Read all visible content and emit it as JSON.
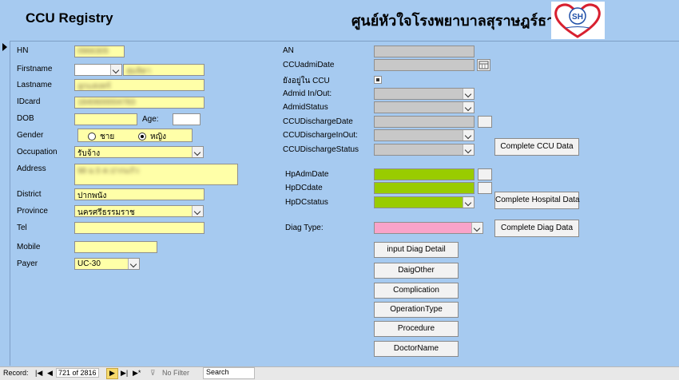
{
  "header": {
    "title": "CCU Registry",
    "hospital": "ศูนย์หัวใจโรงพยาบาลสุราษฎร์ธานี",
    "logo_text": "SH"
  },
  "left": {
    "hn_label": "HN",
    "hn_value": "0966305",
    "firstname_label": "Firstname",
    "firstname_value": "สุมลิตา",
    "lastname_label": "Lastname",
    "lastname_value": "ลูกแสงทร์",
    "idcard_label": "IDcard",
    "idcard_value": "1840600004783",
    "dob_label": "DOB",
    "dob_value": "",
    "age_label": "Age:",
    "age_value": "",
    "gender_label": "Gender",
    "gender_male": "ชาย",
    "gender_female": "หญิง",
    "occupation_label": "Occupation",
    "occupation_value": "รับจ้าง",
    "address_label": "Address",
    "address_value": "98 ม.5 ต.ปากแก้ว",
    "district_label": "District",
    "district_value": "ปากพนัง",
    "province_label": "Province",
    "province_value": "นครศรีธรรมราช",
    "tel_label": "Tel",
    "tel_value": "",
    "mobile_label": "Mobile",
    "mobile_value": "",
    "payer_label": "Payer",
    "payer_value": "UC-30"
  },
  "right": {
    "an_label": "AN",
    "ccu_admit_date_label": "CCUadmiDate",
    "still_in_ccu_label": "ยังอยู่ใน CCU",
    "admid_inout_label": "Admid In/Out:",
    "admid_status_label": "AdmidStatus",
    "discharge_date_label": "CCUDischargeDate",
    "discharge_inout_label": "CCUDischargeInOut:",
    "discharge_status_label": "CCUDischargeStatus",
    "complete_ccu_button": "Complete CCU Data",
    "hp_adm_date_label": "HpAdmDate",
    "hp_dc_date_label": "HpDCdate",
    "hp_dc_status_label": "HpDCstatus",
    "complete_hospital_button": "Complete Hospital Data",
    "diag_type_label": "Diag Type:",
    "complete_diag_button": "Complete Diag Data",
    "buttons": [
      "input Diag Detail",
      "DaigOther",
      "Complication",
      "OperationType",
      "Procedure",
      "DoctorName"
    ]
  },
  "statusbar": {
    "record_label": "Record:",
    "record_position": "721 of 2816",
    "no_filter": "No Filter",
    "search": "Search"
  }
}
